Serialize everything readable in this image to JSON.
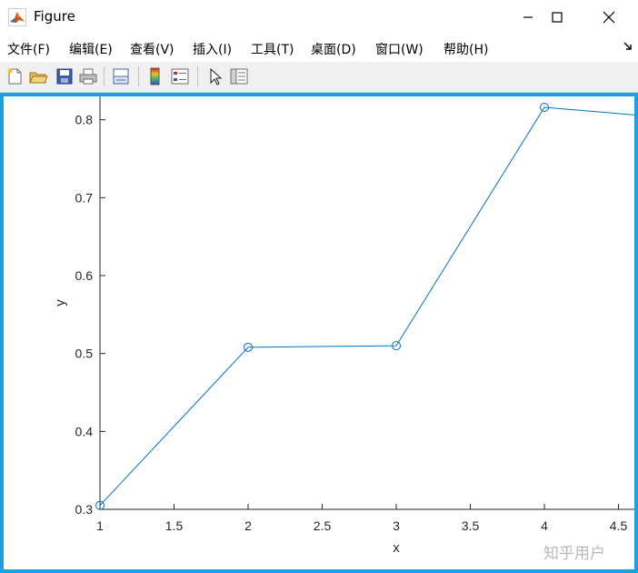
{
  "window": {
    "title": "Figure",
    "controls": {
      "minimize": "minimize",
      "maximize": "maximize",
      "close": "close"
    }
  },
  "menu": {
    "items": [
      "文件(F)",
      "编辑(E)",
      "查看(V)",
      "插入(I)",
      "工具(T)",
      "桌面(D)",
      "窗口(W)",
      "帮助(H)"
    ]
  },
  "toolbar": {
    "buttons": [
      "new-figure-icon",
      "open-file-icon",
      "save-icon",
      "print-icon",
      "link-plot-icon",
      "colorbar-icon",
      "legend-icon",
      "select-arrow-icon",
      "property-editor-icon"
    ]
  },
  "colors": {
    "line": "#0072bd",
    "frame_border": "#1ba1e2",
    "axes": "#262626"
  },
  "watermark": "知乎用户",
  "chart_data": {
    "type": "line",
    "marker": "circle",
    "x": [
      1,
      2,
      3,
      4,
      5
    ],
    "y": [
      0.305,
      0.508,
      0.51,
      0.816,
      0.8
    ],
    "xlabel": "x",
    "ylabel": "y",
    "xlim": [
      1,
      4.6
    ],
    "ylim": [
      0.3,
      0.83
    ],
    "xticks": [
      1,
      1.5,
      2,
      2.5,
      3,
      3.5,
      4,
      4.5
    ],
    "xtick_labels": [
      "1",
      "1.5",
      "2",
      "2.5",
      "3",
      "3.5",
      "4",
      "4.5"
    ],
    "yticks": [
      0.3,
      0.4,
      0.5,
      0.6,
      0.7,
      0.8
    ],
    "ytick_labels": [
      "0.3",
      "0.4",
      "0.5",
      "0.6",
      "0.7",
      "0.8"
    ],
    "grid": false,
    "box": true
  }
}
